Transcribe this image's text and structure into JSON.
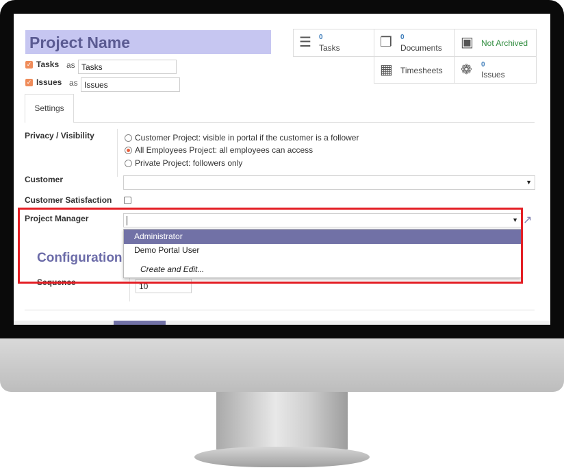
{
  "project": {
    "name": "Project Name"
  },
  "aliases": [
    {
      "label": "Tasks",
      "as": "as",
      "value": "Tasks"
    },
    {
      "label": "Issues",
      "as": "as",
      "value": "Issues"
    }
  ],
  "stats": {
    "tasks": {
      "count": "0",
      "label": "Tasks",
      "icon": "tasks-icon"
    },
    "documents": {
      "count": "0",
      "label": "Documents",
      "icon": "documents-icon"
    },
    "archive": {
      "label": "Not Archived",
      "icon": "archive-icon",
      "color": "#2e8b3d"
    },
    "timesheets": {
      "label": "Timesheets",
      "icon": "calendar-icon"
    },
    "issues": {
      "count": "0",
      "label": "Issues",
      "icon": "bug-icon"
    }
  },
  "tabs": {
    "settings": "Settings"
  },
  "fields": {
    "privacy": {
      "label": "Privacy / Visibility",
      "options": [
        "Customer Project: visible in portal if the customer is a follower",
        "All Employees Project: all employees can access",
        "Private Project: followers only"
      ],
      "selected_index": 1
    },
    "customer": {
      "label": "Customer",
      "value": ""
    },
    "customer_satisfaction": {
      "label": "Customer Satisfaction",
      "checked": false
    },
    "project_manager": {
      "label": "Project Manager",
      "value": "",
      "dropdown_options": [
        "Administrator",
        "Demo Portal User"
      ],
      "create_edit": "Create and Edit...",
      "highlighted": "Administrator"
    }
  },
  "configuration": {
    "title": "Configuration",
    "sequence_label": "Sequence",
    "sequence_value": "10"
  },
  "colors": {
    "accent": "#7171a6",
    "highlight_outline": "#e31e24",
    "checkbox_checked": "#ef8c5a",
    "project_name_bg": "#c6c6f1"
  }
}
